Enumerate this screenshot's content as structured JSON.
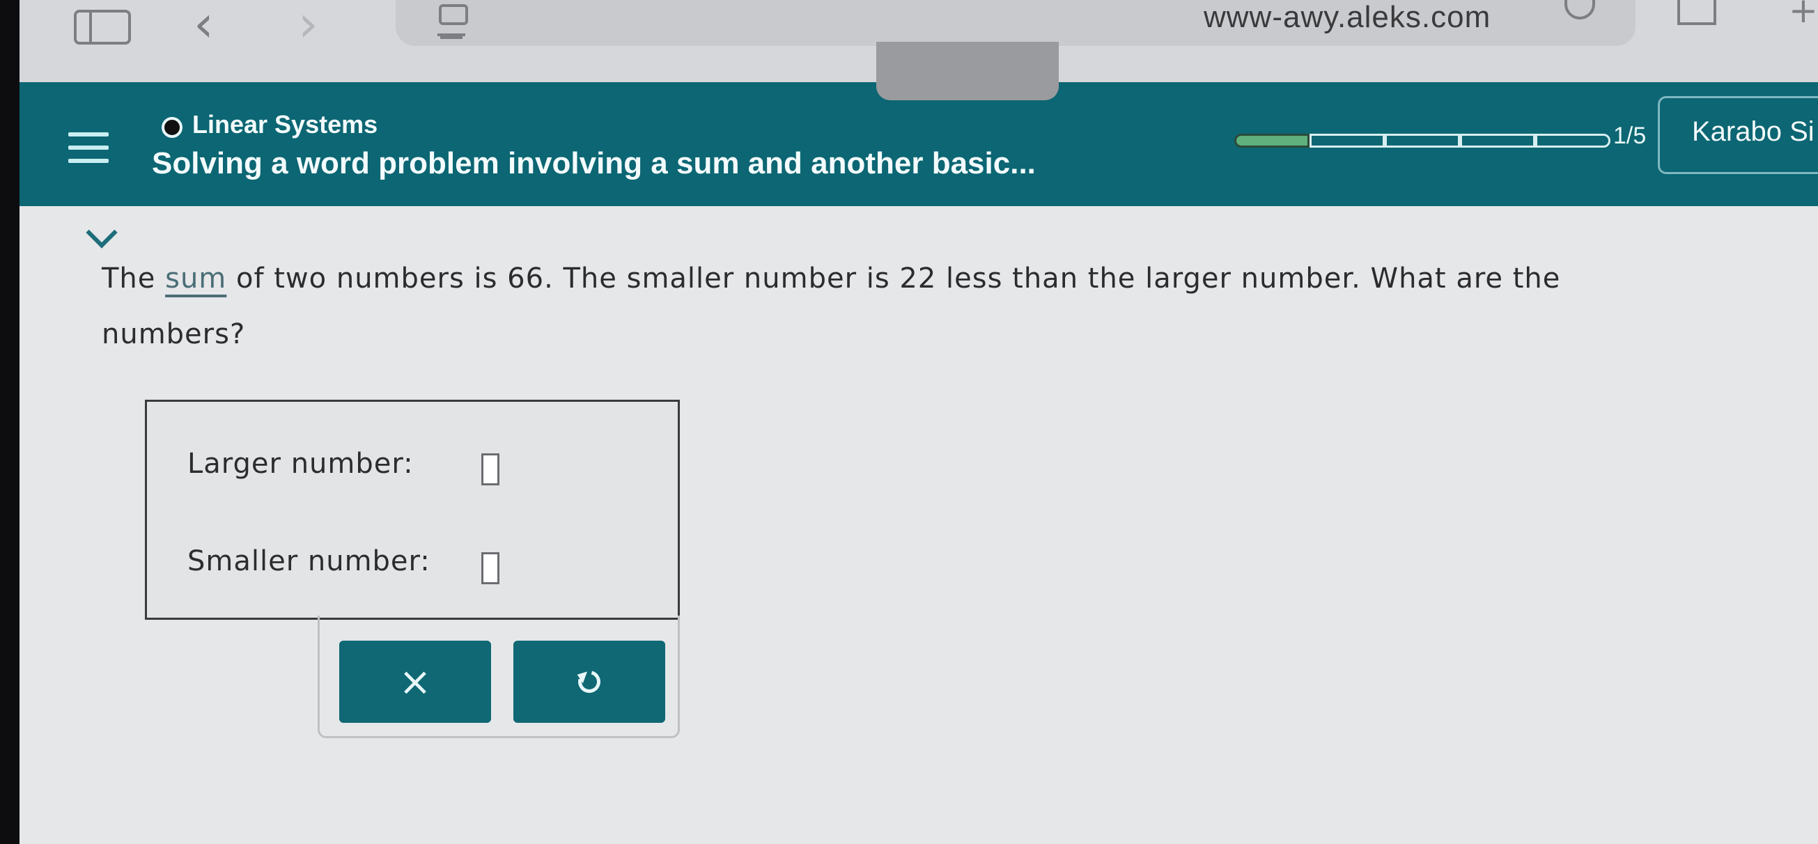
{
  "browser": {
    "url": "www-awy.aleks.com"
  },
  "header": {
    "topic": "Linear Systems",
    "lesson_title": "Solving a word problem involving a sum and another basic...",
    "progress_label": "1/5",
    "progress": {
      "completed": 1,
      "total": 5
    },
    "user_name": "Karabo Si"
  },
  "problem": {
    "text_before": "The ",
    "sum_link": "sum",
    "text_after": " of two numbers is 66. The smaller number is 22 less than the larger number. What are the numbers?"
  },
  "answers": {
    "larger_label": "Larger number:",
    "smaller_label": "Smaller number:",
    "larger_value": "",
    "smaller_value": ""
  },
  "buttons": {
    "clear_symbol": "×",
    "undo_icon": "undo-icon"
  },
  "colors": {
    "header_teal": "#0c6673",
    "button_teal": "#0f6874",
    "progress_fill": "#5fb07c"
  }
}
